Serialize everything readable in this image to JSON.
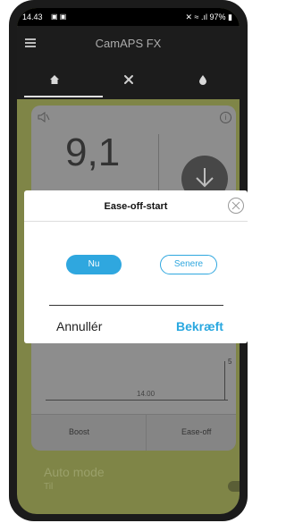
{
  "status_bar": {
    "time": "14.43",
    "battery": "97%"
  },
  "app": {
    "title": "CamAPS FX"
  },
  "tabs": [
    {
      "name": "home",
      "icon": "home-icon"
    },
    {
      "name": "tools",
      "icon": "tools-icon"
    },
    {
      "name": "drop",
      "icon": "drop-icon"
    }
  ],
  "card": {
    "glucose_value": "9,1",
    "chart_tick_right": "5",
    "chart_time": "14.00",
    "boost_label": "Boost",
    "easeoff_label": "Ease-off"
  },
  "auto_mode": {
    "title": "Auto mode",
    "subtitle": "Til",
    "enabled": true
  },
  "dialog": {
    "title": "Ease-off-start",
    "now_button": "Nu",
    "later_button": "Senere",
    "cancel_button": "Annullér",
    "confirm_button": "Bekræft"
  },
  "colors": {
    "accent": "#2fa7df",
    "app_bar": "#1c1c1c",
    "background_dimmed": "#7f8547"
  }
}
